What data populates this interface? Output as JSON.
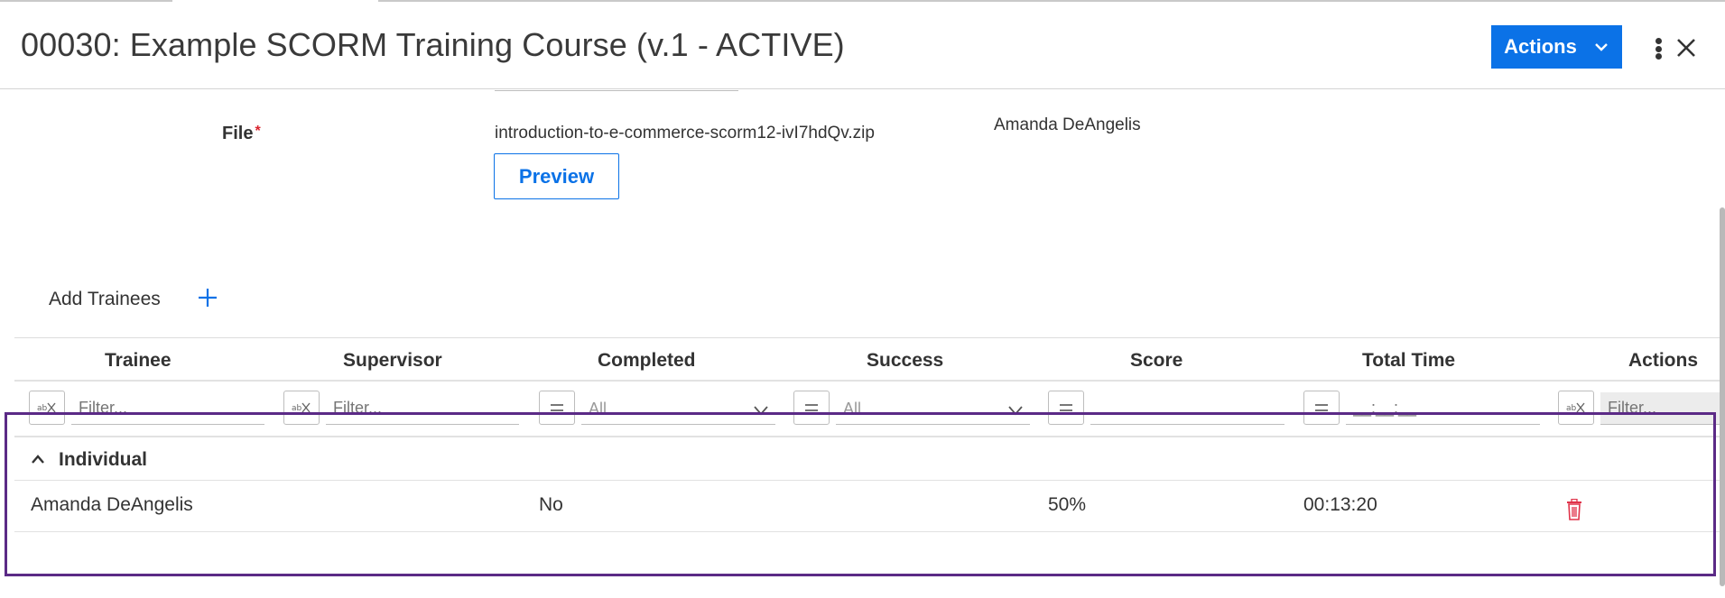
{
  "header": {
    "title": "00030: Example SCORM Training Course (v.1 - ACTIVE)",
    "actions_label": "Actions"
  },
  "file_section": {
    "label": "File",
    "required_mark": "*",
    "file_name": "introduction-to-e-commerce-scorm12-ivI7hdQv.zip",
    "owner": "Amanda DeAngelis",
    "preview_label": "Preview"
  },
  "trainees": {
    "add_label": "Add Trainees",
    "columns": [
      "Trainee",
      "Supervisor",
      "Completed",
      "Success",
      "Score",
      "Total Time",
      "Actions"
    ],
    "filters": {
      "trainee_placeholder": "Filter...",
      "supervisor_placeholder": "Filter...",
      "completed_value": "All",
      "success_value": "All",
      "score_value": "",
      "total_time_placeholder": "__:__:__",
      "actions_placeholder": "Filter..."
    },
    "group": {
      "label": "Individual"
    },
    "rows": [
      {
        "trainee": "Amanda DeAngelis",
        "supervisor": "",
        "completed": "No",
        "success": "",
        "score": "50%",
        "total_time": "00:13:20"
      }
    ]
  },
  "colors": {
    "accent": "#0b72e7",
    "danger": "#d9232d",
    "highlight": "#5b2a86"
  },
  "icons": [
    "chevron-down-icon",
    "kebab-menu-icon",
    "close-icon",
    "plus-icon",
    "filter-text-icon",
    "filter-equals-icon",
    "caret-up-icon",
    "trash-icon"
  ]
}
